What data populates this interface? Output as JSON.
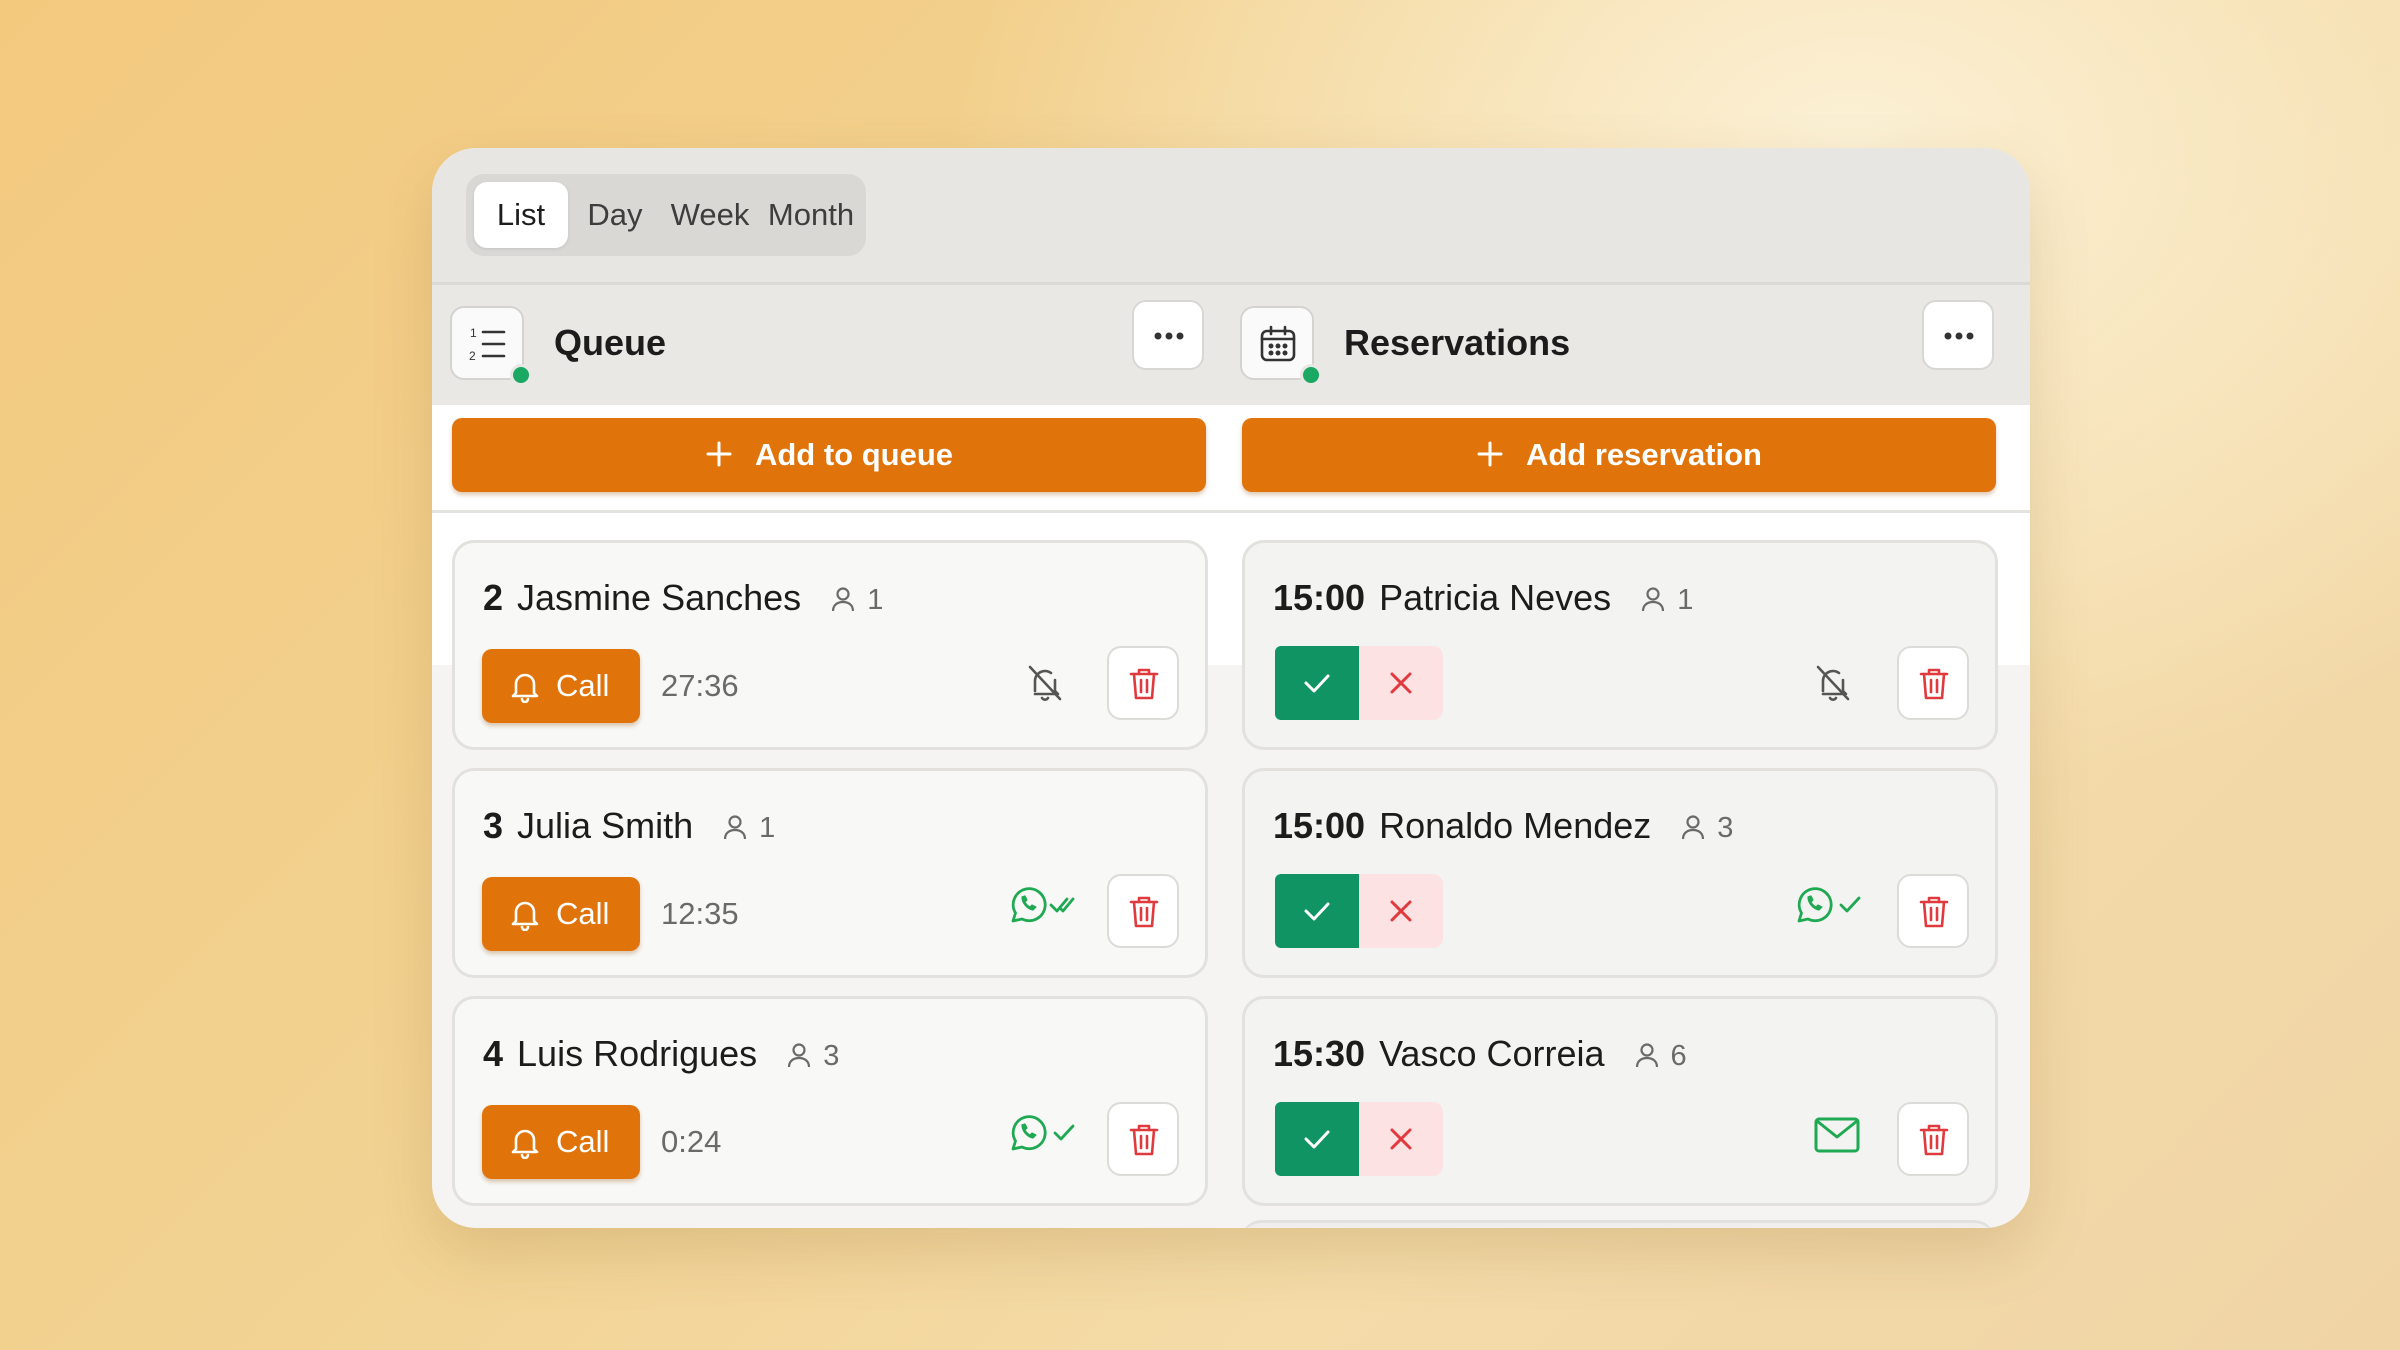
{
  "views": {
    "tabs": [
      {
        "label": "List",
        "active": true
      },
      {
        "label": "Day",
        "active": false
      },
      {
        "label": "Week",
        "active": false
      },
      {
        "label": "Month",
        "active": false
      }
    ]
  },
  "queue": {
    "title": "Queue",
    "add_label": "Add to queue",
    "items": [
      {
        "number": "2",
        "name": "Jasmine Sanches",
        "party": "1",
        "call_label": "Call",
        "wait": "27:36",
        "notify": "muted"
      },
      {
        "number": "3",
        "name": "Julia Smith",
        "party": "1",
        "call_label": "Call",
        "wait": "12:35",
        "notify": "whatsapp-read"
      },
      {
        "number": "4",
        "name": "Luis Rodrigues",
        "party": "3",
        "call_label": "Call",
        "wait": "0:24",
        "notify": "whatsapp-sent"
      }
    ]
  },
  "reservations": {
    "title": "Reservations",
    "add_label": "Add reservation",
    "items": [
      {
        "time": "15:00",
        "name": "Patricia Neves",
        "party": "1",
        "notify": "muted"
      },
      {
        "time": "15:00",
        "name": "Ronaldo Mendez",
        "party": "3",
        "notify": "whatsapp-sent"
      },
      {
        "time": "15:30",
        "name": "Vasco Correia",
        "party": "6",
        "notify": "email"
      }
    ]
  },
  "colors": {
    "accent_orange": "#e0740b",
    "confirm_green": "#109463",
    "whatsapp_green": "#1ea952",
    "danger_red": "#e03a3e",
    "status_online": "#1aa862"
  }
}
